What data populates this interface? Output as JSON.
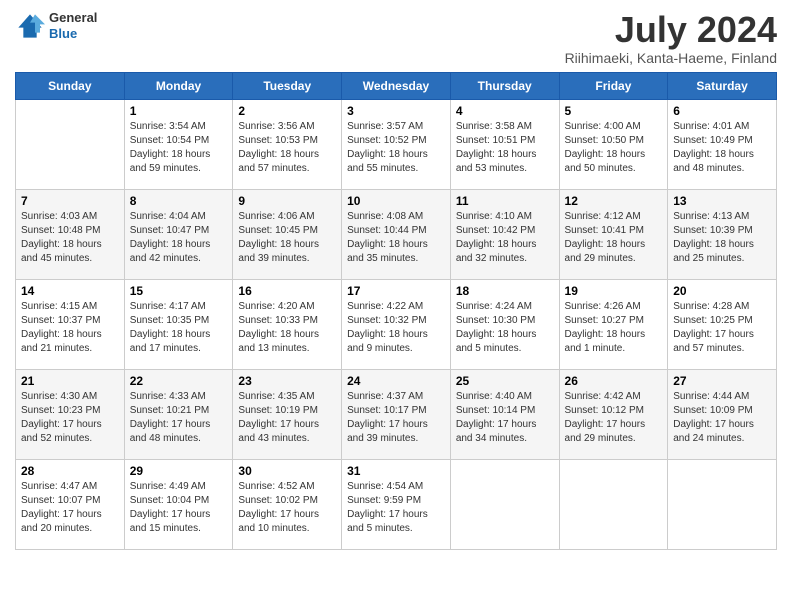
{
  "header": {
    "logo": {
      "general": "General",
      "blue": "Blue"
    },
    "title": "July 2024",
    "location": "Riihimaeki, Kanta-Haeme, Finland"
  },
  "columns": [
    "Sunday",
    "Monday",
    "Tuesday",
    "Wednesday",
    "Thursday",
    "Friday",
    "Saturday"
  ],
  "weeks": [
    [
      {
        "day": "",
        "content": ""
      },
      {
        "day": "1",
        "content": "Sunrise: 3:54 AM\nSunset: 10:54 PM\nDaylight: 18 hours\nand 59 minutes."
      },
      {
        "day": "2",
        "content": "Sunrise: 3:56 AM\nSunset: 10:53 PM\nDaylight: 18 hours\nand 57 minutes."
      },
      {
        "day": "3",
        "content": "Sunrise: 3:57 AM\nSunset: 10:52 PM\nDaylight: 18 hours\nand 55 minutes."
      },
      {
        "day": "4",
        "content": "Sunrise: 3:58 AM\nSunset: 10:51 PM\nDaylight: 18 hours\nand 53 minutes."
      },
      {
        "day": "5",
        "content": "Sunrise: 4:00 AM\nSunset: 10:50 PM\nDaylight: 18 hours\nand 50 minutes."
      },
      {
        "day": "6",
        "content": "Sunrise: 4:01 AM\nSunset: 10:49 PM\nDaylight: 18 hours\nand 48 minutes."
      }
    ],
    [
      {
        "day": "7",
        "content": "Sunrise: 4:03 AM\nSunset: 10:48 PM\nDaylight: 18 hours\nand 45 minutes."
      },
      {
        "day": "8",
        "content": "Sunrise: 4:04 AM\nSunset: 10:47 PM\nDaylight: 18 hours\nand 42 minutes."
      },
      {
        "day": "9",
        "content": "Sunrise: 4:06 AM\nSunset: 10:45 PM\nDaylight: 18 hours\nand 39 minutes."
      },
      {
        "day": "10",
        "content": "Sunrise: 4:08 AM\nSunset: 10:44 PM\nDaylight: 18 hours\nand 35 minutes."
      },
      {
        "day": "11",
        "content": "Sunrise: 4:10 AM\nSunset: 10:42 PM\nDaylight: 18 hours\nand 32 minutes."
      },
      {
        "day": "12",
        "content": "Sunrise: 4:12 AM\nSunset: 10:41 PM\nDaylight: 18 hours\nand 29 minutes."
      },
      {
        "day": "13",
        "content": "Sunrise: 4:13 AM\nSunset: 10:39 PM\nDaylight: 18 hours\nand 25 minutes."
      }
    ],
    [
      {
        "day": "14",
        "content": "Sunrise: 4:15 AM\nSunset: 10:37 PM\nDaylight: 18 hours\nand 21 minutes."
      },
      {
        "day": "15",
        "content": "Sunrise: 4:17 AM\nSunset: 10:35 PM\nDaylight: 18 hours\nand 17 minutes."
      },
      {
        "day": "16",
        "content": "Sunrise: 4:20 AM\nSunset: 10:33 PM\nDaylight: 18 hours\nand 13 minutes."
      },
      {
        "day": "17",
        "content": "Sunrise: 4:22 AM\nSunset: 10:32 PM\nDaylight: 18 hours\nand 9 minutes."
      },
      {
        "day": "18",
        "content": "Sunrise: 4:24 AM\nSunset: 10:30 PM\nDaylight: 18 hours\nand 5 minutes."
      },
      {
        "day": "19",
        "content": "Sunrise: 4:26 AM\nSunset: 10:27 PM\nDaylight: 18 hours\nand 1 minute."
      },
      {
        "day": "20",
        "content": "Sunrise: 4:28 AM\nSunset: 10:25 PM\nDaylight: 17 hours\nand 57 minutes."
      }
    ],
    [
      {
        "day": "21",
        "content": "Sunrise: 4:30 AM\nSunset: 10:23 PM\nDaylight: 17 hours\nand 52 minutes."
      },
      {
        "day": "22",
        "content": "Sunrise: 4:33 AM\nSunset: 10:21 PM\nDaylight: 17 hours\nand 48 minutes."
      },
      {
        "day": "23",
        "content": "Sunrise: 4:35 AM\nSunset: 10:19 PM\nDaylight: 17 hours\nand 43 minutes."
      },
      {
        "day": "24",
        "content": "Sunrise: 4:37 AM\nSunset: 10:17 PM\nDaylight: 17 hours\nand 39 minutes."
      },
      {
        "day": "25",
        "content": "Sunrise: 4:40 AM\nSunset: 10:14 PM\nDaylight: 17 hours\nand 34 minutes."
      },
      {
        "day": "26",
        "content": "Sunrise: 4:42 AM\nSunset: 10:12 PM\nDaylight: 17 hours\nand 29 minutes."
      },
      {
        "day": "27",
        "content": "Sunrise: 4:44 AM\nSunset: 10:09 PM\nDaylight: 17 hours\nand 24 minutes."
      }
    ],
    [
      {
        "day": "28",
        "content": "Sunrise: 4:47 AM\nSunset: 10:07 PM\nDaylight: 17 hours\nand 20 minutes."
      },
      {
        "day": "29",
        "content": "Sunrise: 4:49 AM\nSunset: 10:04 PM\nDaylight: 17 hours\nand 15 minutes."
      },
      {
        "day": "30",
        "content": "Sunrise: 4:52 AM\nSunset: 10:02 PM\nDaylight: 17 hours\nand 10 minutes."
      },
      {
        "day": "31",
        "content": "Sunrise: 4:54 AM\nSunset: 9:59 PM\nDaylight: 17 hours\nand 5 minutes."
      },
      {
        "day": "",
        "content": ""
      },
      {
        "day": "",
        "content": ""
      },
      {
        "day": "",
        "content": ""
      }
    ]
  ]
}
